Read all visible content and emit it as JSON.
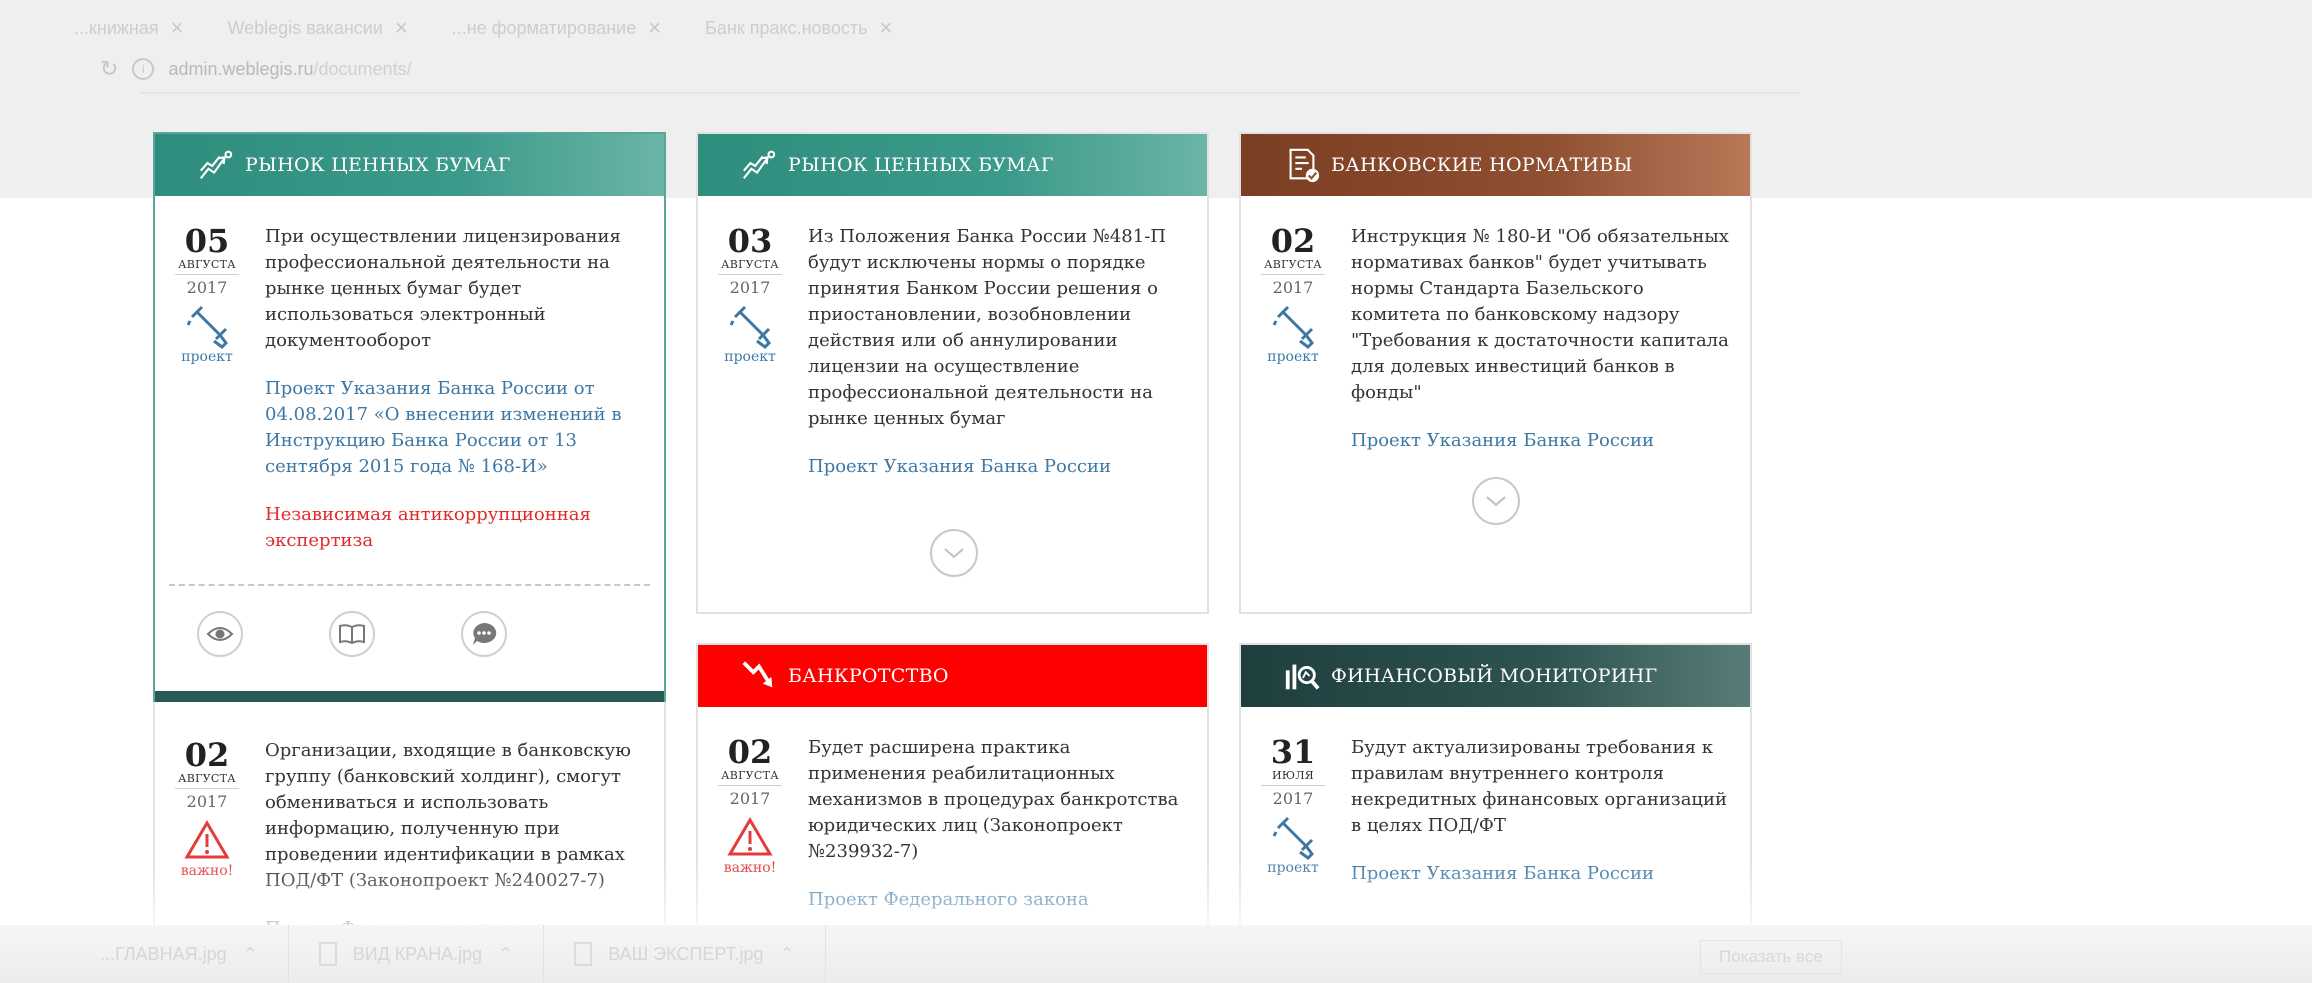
{
  "browser": {
    "tabs": [
      {
        "label": "...книжная"
      },
      {
        "label": "Weblegis  вакансии"
      },
      {
        "label": "...не форматирование"
      },
      {
        "label": "Банк пракс.новость"
      }
    ],
    "url_host": "admin.weblegis.ru",
    "url_path": "/documents/"
  },
  "cards": [
    {
      "category": "РЫНОК ЦЕННЫХ БУМАГ",
      "day": "05",
      "month": "АВГУСТА",
      "year": "2017",
      "status": "проект",
      "text": "При осуществлении лицензирования профессиональной деятельности на рынке ценных бумаг будет использоваться электронный документооборот",
      "link": "Проект Указания Банка России от 04.08.2017 «О внесении изменений в Инструкцию Банка России от 13 сентября 2015 года № 168-И»",
      "alert": "Независимая антикоррупционная экспертиза"
    },
    {
      "category": "РЫНОК ЦЕННЫХ БУМАГ",
      "day": "03",
      "month": "АВГУСТА",
      "year": "2017",
      "status": "проект",
      "text": "Из Положения Банка России №481-П будут исключены нормы о порядке принятия Банком России решения о приостановлении, возобновлении действия или об аннулировании лицензии на осуществление профессиональной деятельности на рынке ценных бумаг",
      "link": "Проект Указания Банка России"
    },
    {
      "category": "БАНКОВСКИЕ НОРМАТИВЫ",
      "day": "02",
      "month": "АВГУСТА",
      "year": "2017",
      "status": "проект",
      "text": "Инструкция № 180-И \"Об обязательных нормативах банков\" будет учитывать нормы Стандарта Базельского комитета по банковскому надзору \"Требования к достаточности капитала для долевых инвестиций банков в фонды\"",
      "link": "Проект Указания Банка России"
    },
    {
      "day": "02",
      "month": "АВГУСТА",
      "year": "2017",
      "status": "важно!",
      "text": "Организации, входящие в банковскую группу (банковский холдинг), смогут обмениваться и использовать информацию, полученную при проведении идентификации в рамках ПОД/ФТ (Законопроект №240027-7)",
      "link": "Проект Федерального закона"
    },
    {
      "category": "БАНКРОТСТВО",
      "day": "02",
      "month": "АВГУСТА",
      "year": "2017",
      "status": "важно!",
      "text": "Будет расширена практика применения реабилитационных механизмов в процедурах банкротства юридических лиц (Законопроект №239932-7)",
      "link": "Проект Федерального закона"
    },
    {
      "category": "ФИНАНСОВЫЙ МОНИТОРИНГ",
      "day": "31",
      "month": "ИЮЛЯ",
      "year": "2017",
      "status": "проект",
      "text": "Будут актуализированы требования к правилам внутреннего контроля некредитных финансовых организаций в целях ПОД/ФТ",
      "link": "Проект Указания Банка России"
    }
  ],
  "downloads": [
    {
      "name": "...ГЛАВНАЯ.jpg"
    },
    {
      "name": "ВИД КРАНА.jpg"
    },
    {
      "name": "ВАШ ЭКСПЕРТ.jpg"
    }
  ],
  "downloads_show_all": "Показать все",
  "colors": {
    "teal": "#3c9a8a",
    "brown": "#8f4f31",
    "red": "#ff0000",
    "dark_teal": "#2e5350",
    "link_blue": "#3d78a5",
    "alert_red": "#e02a2a"
  },
  "icons": {
    "securities": "trend-chart-icon",
    "bank_norms": "document-check-icon",
    "bankruptcy": "falling-arrow-icon",
    "monitoring": "magnifier-bars-icon",
    "project": "pen-icon",
    "important": "warning-icon"
  }
}
